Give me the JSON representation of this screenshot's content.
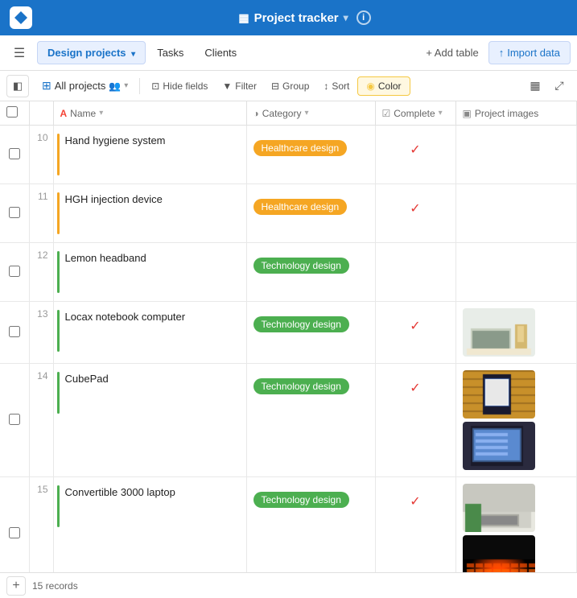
{
  "app": {
    "logo_alt": "App logo",
    "title": "Project tracker",
    "title_icon": "▦",
    "info_icon": "i"
  },
  "nav": {
    "hamburger": "☰",
    "tabs": [
      {
        "id": "design-projects",
        "label": "Design projects",
        "active": true,
        "arrow": true
      },
      {
        "id": "tasks",
        "label": "Tasks",
        "active": false
      },
      {
        "id": "clients",
        "label": "Clients",
        "active": false
      }
    ],
    "add_table": "+ Add table",
    "import_btn": "⬆ Import data"
  },
  "view_bar": {
    "sidebar_icon": "☰",
    "view_name": "All projects",
    "view_icon": "⊞",
    "people_icon": "👥",
    "arrow": "▾",
    "hide_fields": "Hide fields",
    "filter": "Filter",
    "group": "Group",
    "sort": "Sort",
    "color": "Color",
    "gallery_icon": "▦",
    "expand_icon": "⤢"
  },
  "columns": [
    {
      "id": "checkbox",
      "label": ""
    },
    {
      "id": "row-num",
      "label": ""
    },
    {
      "id": "name",
      "label": "Name",
      "icon": "A"
    },
    {
      "id": "category",
      "label": "Category",
      "icon": "◑"
    },
    {
      "id": "complete",
      "label": "Complete",
      "icon": "✓"
    },
    {
      "id": "images",
      "label": "Project images",
      "icon": "▣"
    }
  ],
  "rows": [
    {
      "id": 10,
      "color": "#f5a623",
      "name": "Hand hygiene system",
      "category": "Healthcare design",
      "category_type": "healthcare",
      "complete": true,
      "has_images": false
    },
    {
      "id": 11,
      "color": "#f5a623",
      "name": "HGH injection device",
      "category": "Healthcare design",
      "category_type": "healthcare",
      "complete": true,
      "has_images": false
    },
    {
      "id": 12,
      "color": "#4caf50",
      "name": "Lemon headband",
      "category": "Technology design",
      "category_type": "technology",
      "complete": false,
      "has_images": false
    },
    {
      "id": 13,
      "color": "#4caf50",
      "name": "Locax notebook computer",
      "category": "Technology design",
      "category_type": "technology",
      "complete": true,
      "has_images": true,
      "images": [
        "laptop"
      ]
    },
    {
      "id": 14,
      "color": "#4caf50",
      "name": "CubePad",
      "category": "Technology design",
      "category_type": "technology",
      "complete": true,
      "has_images": true,
      "images": [
        "tablet1",
        "tablet2"
      ]
    },
    {
      "id": 15,
      "color": "#4caf50",
      "name": "Convertible 3000 laptop",
      "category": "Technology design",
      "category_type": "technology",
      "complete": true,
      "has_images": true,
      "images": [
        "laptop2",
        "dark"
      ]
    }
  ],
  "bottom_bar": {
    "add_icon": "+",
    "record_count": "15 records"
  }
}
